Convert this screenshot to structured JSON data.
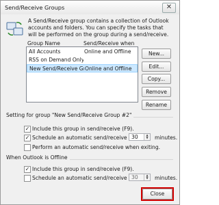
{
  "window": {
    "title": "Send/Receive Groups",
    "close_glyph": "✕"
  },
  "description": "A Send/Receive group contains a collection of Outlook accounts and folders. You can specify the tasks that will be performed on the group during a send/receive.",
  "list": {
    "col_group_name": "Group Name",
    "col_when": "Send/Receive when",
    "rows": [
      {
        "name": "All Accounts",
        "when": "Online and Offline"
      },
      {
        "name": "RSS on Demand Only",
        "when": ""
      },
      {
        "name": "New Send/Receive Grou...",
        "when": "Online and Offline"
      }
    ],
    "selected_index": 2
  },
  "buttons": {
    "new": "New...",
    "edit": "Edit...",
    "copy": "Copy...",
    "remove": "Remove",
    "rename": "Rename",
    "close": "Close"
  },
  "online_section": {
    "title": "Setting for group \"New Send/Receive Group #2\"",
    "include": {
      "label": "Include this group in send/receive (F9).",
      "checked": true
    },
    "schedule": {
      "label": "Schedule an automatic send/receive every",
      "checked": true,
      "value": "30",
      "unit": "minutes."
    },
    "exit": {
      "label": "Perform an automatic send/receive when exiting.",
      "checked": false
    }
  },
  "offline_section": {
    "title": "When Outlook is Offline",
    "include": {
      "label": "Include this group in send/receive (F9).",
      "checked": true
    },
    "schedule": {
      "label": "Schedule an automatic send/receive every",
      "checked": false,
      "value": "30",
      "unit": "minutes."
    }
  },
  "icons": {
    "header": "sync-icon"
  },
  "colors": {
    "selection": "#cce8ff",
    "highlight": "#d20000"
  }
}
